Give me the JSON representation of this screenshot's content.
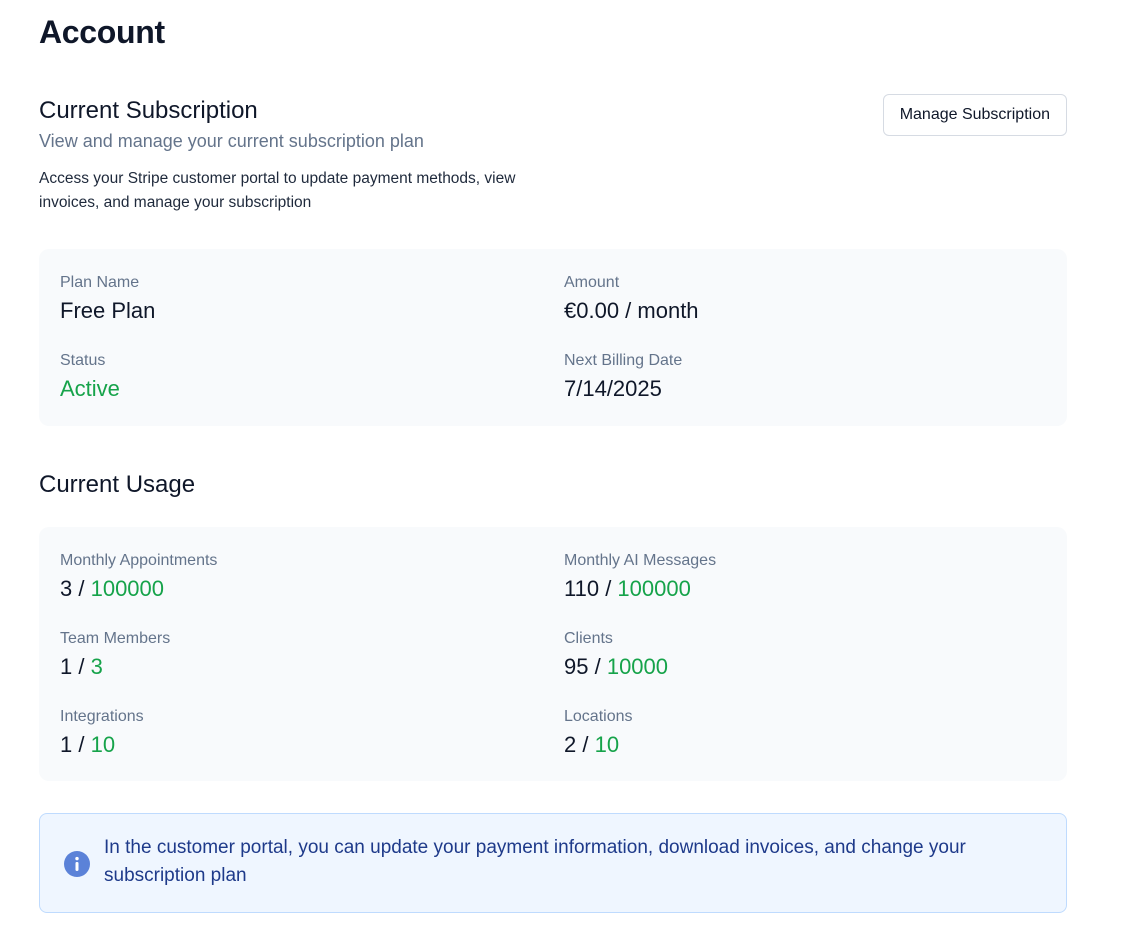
{
  "page": {
    "title": "Account"
  },
  "subscription": {
    "title": "Current Subscription",
    "description": "View and manage your current subscription plan",
    "note": "Access your Stripe customer portal to update payment methods, view invoices, and manage your subscription",
    "manage_button_label": "Manage Subscription"
  },
  "plan": {
    "name_label": "Plan Name",
    "name_value": "Free Plan",
    "amount_label": "Amount",
    "amount_value": "€0.00 / month",
    "status_label": "Status",
    "status_value": "Active",
    "billing_label": "Next Billing Date",
    "billing_value": "7/14/2025"
  },
  "usage": {
    "title": "Current Usage",
    "items": [
      {
        "label": "Monthly Appointments",
        "used": "3",
        "limit": "100000"
      },
      {
        "label": "Monthly AI Messages",
        "used": "110",
        "limit": "100000"
      },
      {
        "label": "Team Members",
        "used": "1",
        "limit": "3"
      },
      {
        "label": "Clients",
        "used": "95",
        "limit": "10000"
      },
      {
        "label": "Integrations",
        "used": "1",
        "limit": "10"
      },
      {
        "label": "Locations",
        "used": "2",
        "limit": "10"
      }
    ]
  },
  "info": {
    "icon": "info-icon",
    "text": "In the customer portal, you can update your payment information, download invoices, and change your subscription plan"
  },
  "colors": {
    "accent_green": "#16a34a",
    "info_blue": "#1e3a8a",
    "info_icon": "#5b82d8"
  }
}
